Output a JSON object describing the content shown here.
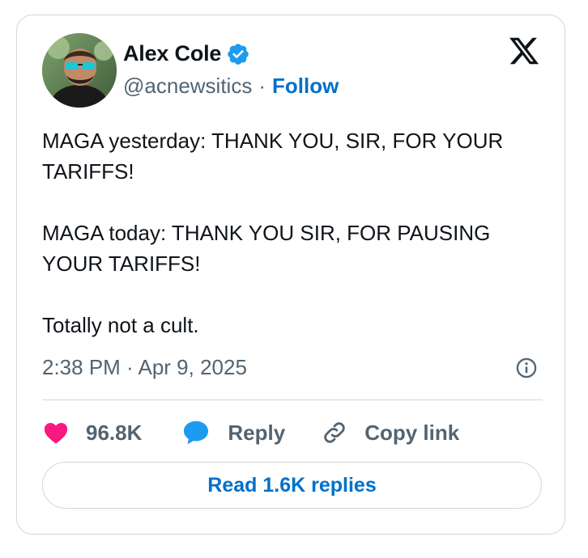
{
  "tweet": {
    "author": {
      "name": "Alex Cole",
      "handle": "@acnewsitics",
      "separator": "·",
      "follow_label": "Follow",
      "verified": true,
      "verified_color": "#1d9bf0",
      "avatar_icon": "avatar-photo"
    },
    "platform_icon": "x-logo-icon",
    "body": [
      "MAGA yesterday: THANK YOU, SIR, FOR YOUR TARIFFS!",
      "MAGA today: THANK YOU SIR, FOR PAUSING YOUR TARIFFS!",
      "Totally not a cult."
    ],
    "timestamp": "2:38 PM · Apr 9, 2025",
    "info_icon": "info-icon",
    "actions": {
      "like_count": "96.8K",
      "like_color": "#f91880",
      "reply_label": "Reply",
      "reply_color": "#1d9bf0",
      "copy_link_label": "Copy link"
    },
    "read_replies_label": "Read 1.6K replies",
    "link_color": "#0070c9"
  }
}
